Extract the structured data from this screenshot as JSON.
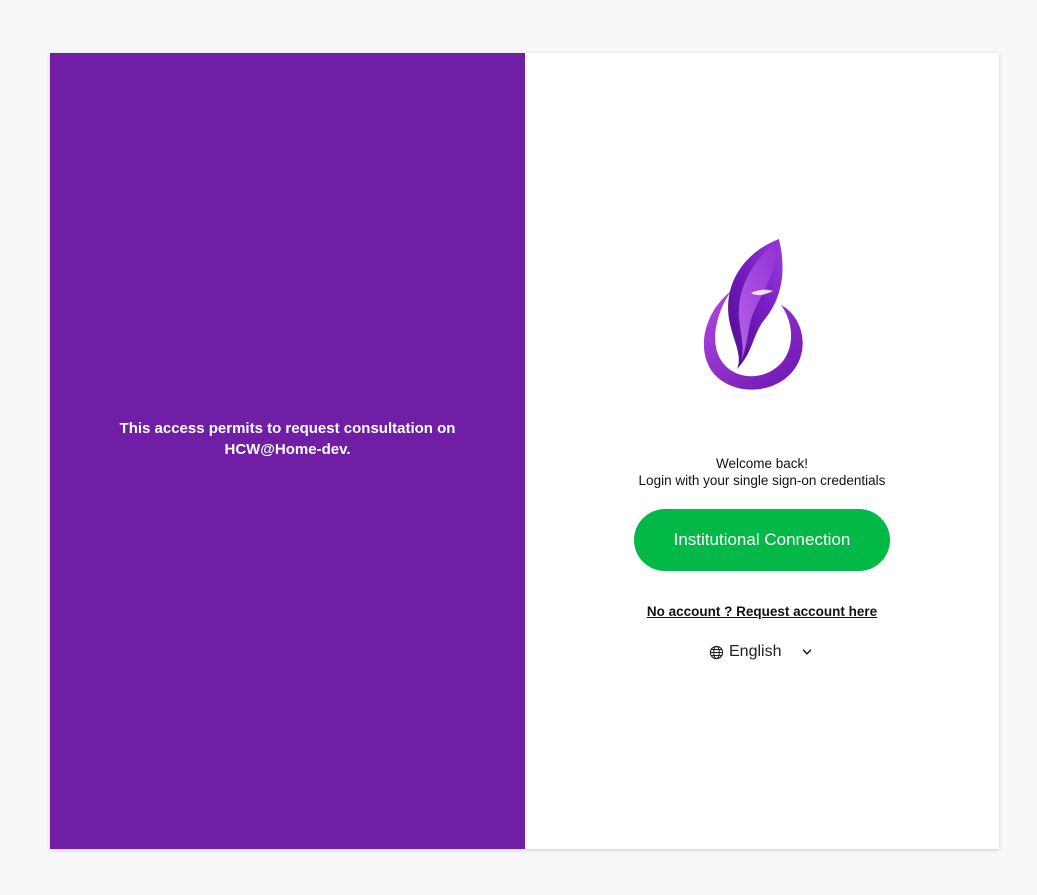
{
  "left_panel": {
    "message": "This access permits to request consultation on HCW@Home-dev."
  },
  "right_panel": {
    "logo_icon": "feather-flame-logo",
    "welcome_title": "Welcome back!",
    "welcome_subtitle": "Login with your single sign-on credentials",
    "sso_button_label": "Institutional Connection",
    "request_account_link": "No account ? Request account here",
    "language": {
      "selected": "English",
      "icon": "globe-icon"
    }
  },
  "colors": {
    "brand_purple": "#6f1ea5",
    "button_green": "#02b846",
    "background": "#f8f8f8"
  }
}
